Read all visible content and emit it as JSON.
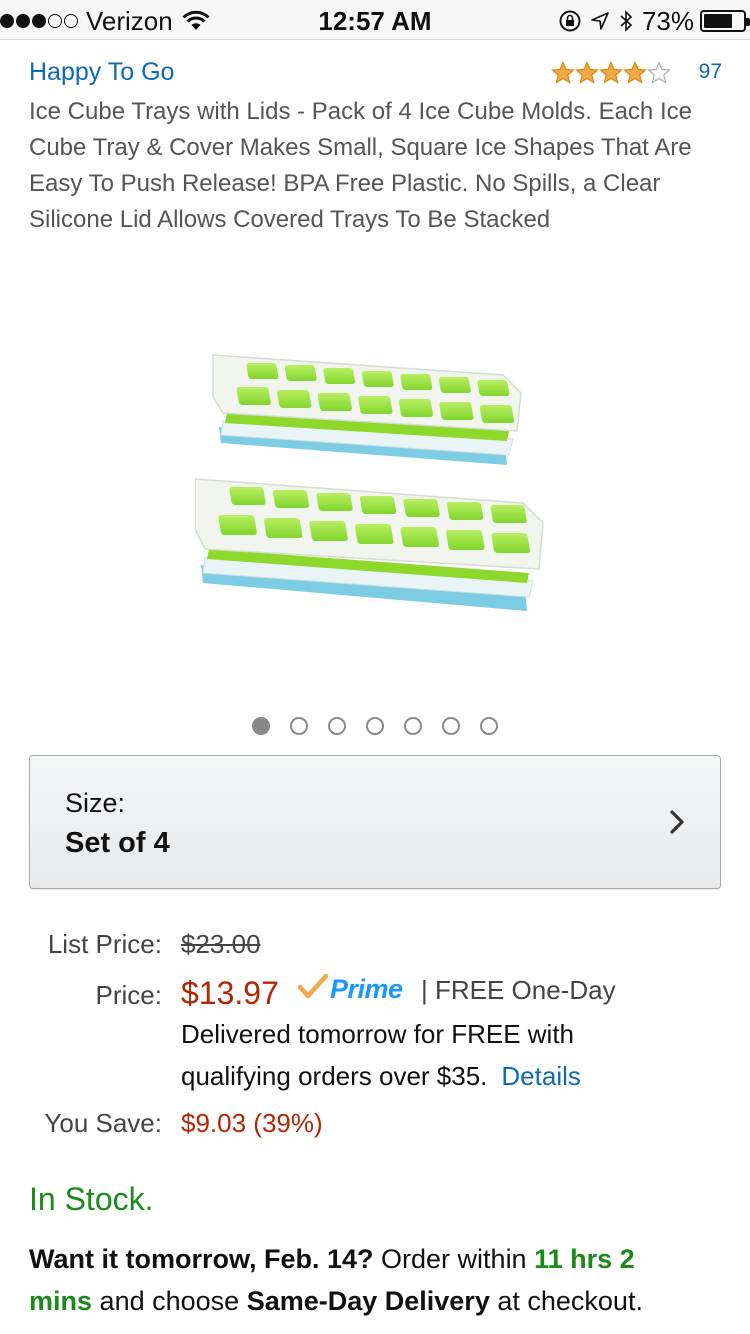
{
  "status_bar": {
    "carrier": "Verizon",
    "time": "12:57 AM",
    "battery_percent": "73%",
    "battery_level": 0.73,
    "signal_bars_filled": 3,
    "signal_bars_total": 5
  },
  "product": {
    "brand": "Happy To Go",
    "rating": 4.0,
    "rating_max": 5,
    "review_count": "97",
    "title": "Ice Cube Trays with Lids - Pack of 4 Ice Cube Molds. Each Ice Cube Tray & Cover Makes Small, Square Ice Shapes That Are Easy To Push Release! BPA Free Plastic. No Spills, a Clear Silicone Lid Allows Covered Trays To Be Stacked",
    "image_count": 7,
    "active_image_index": 0
  },
  "size": {
    "label": "Size:",
    "value": "Set of 4"
  },
  "pricing": {
    "list_price_label": "List Price:",
    "list_price": "$23.00",
    "price_label": "Price:",
    "price": "$13.97",
    "prime_label": "Prime",
    "delivery_line1": "| FREE One-Day",
    "delivery_line2": "Delivered tomorrow for FREE with",
    "delivery_line3": "qualifying orders over $35.",
    "details_link": "Details",
    "you_save_label": "You Save:",
    "you_save": "$9.03 (39%)"
  },
  "availability": {
    "in_stock": "In Stock.",
    "want_it": "Want it tomorrow, Feb. 14?",
    "order_within": "Order within",
    "countdown_part1": "11 hrs 2",
    "countdown_part2": "mins",
    "and_choose": "and choose",
    "same_day": "Same-Day Delivery",
    "at_checkout": "at checkout."
  },
  "colors": {
    "link_blue": "#0d6ab8",
    "price_red": "#b12704",
    "stock_green": "#1b8a1b",
    "prime_blue": "#1a98ff",
    "star_orange": "#f3a847"
  }
}
